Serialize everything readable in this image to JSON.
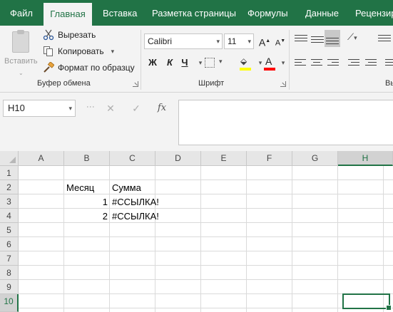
{
  "ribbon": {
    "tabs": [
      "Файл",
      "Главная",
      "Вставка",
      "Разметка страницы",
      "Формулы",
      "Данные",
      "Рецензиро"
    ],
    "active_tab": "Главная",
    "clipboard": {
      "paste_label": "Вставить",
      "cut_label": "Вырезать",
      "copy_label": "Копировать",
      "format_painter_label": "Формат по образцу",
      "group_label": "Буфер обмена"
    },
    "font": {
      "font_name": "Calibri",
      "font_size": "11",
      "grow_label": "A",
      "shrink_label": "A",
      "bold_label": "Ж",
      "italic_label": "К",
      "underline_label": "Ч",
      "font_color_label": "A",
      "group_label": "Шрифт",
      "highlight_color": "#ffff00",
      "font_color": "#ff0000"
    },
    "alignment": {
      "group_label": "Вы"
    },
    "accent_color": "#217346"
  },
  "formula_bar": {
    "name_box": "H10",
    "cancel_icon": "✕",
    "enter_icon": "✓",
    "fx_label": "fx",
    "formula": ""
  },
  "sheet": {
    "columns": [
      "A",
      "B",
      "C",
      "D",
      "E",
      "F",
      "G",
      "H"
    ],
    "rows": [
      "1",
      "2",
      "3",
      "4",
      "5",
      "6",
      "7",
      "8",
      "9",
      "10"
    ],
    "selected_cell": "H10",
    "cells": {
      "B2": "Месяц",
      "C2": "Сумма",
      "B3": "1",
      "C3": "#ССЫЛКА!",
      "B4": "2",
      "C4": "#ССЫЛКА!"
    }
  }
}
